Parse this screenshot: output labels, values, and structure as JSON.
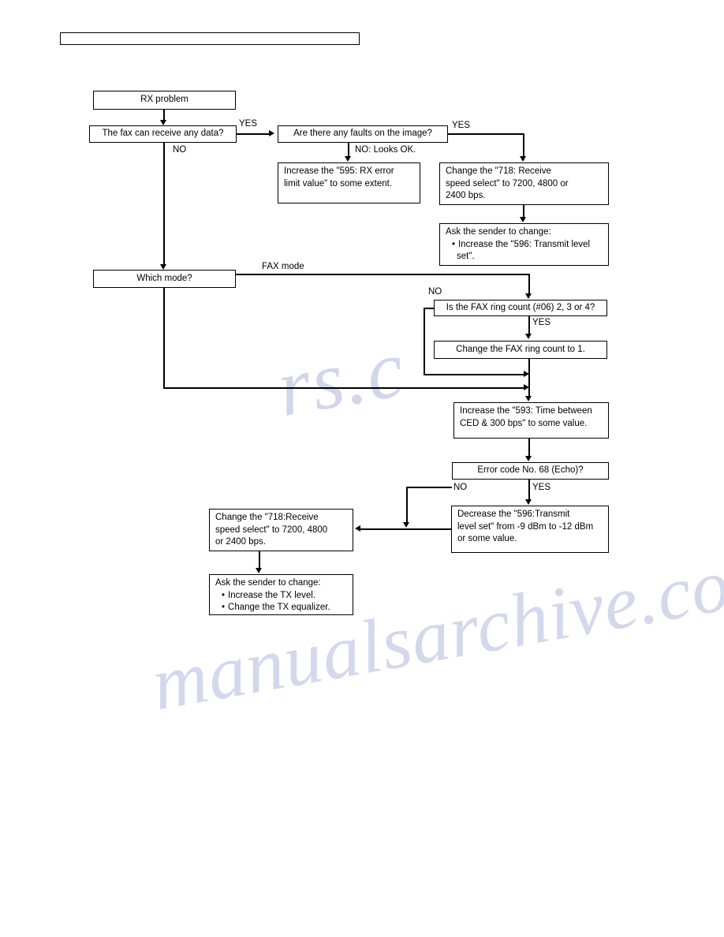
{
  "document": {
    "title": "RX problem troubleshooting flowchart",
    "header_rule_text": ""
  },
  "watermark": {
    "line1": "rs.c",
    "line2": "manualsarchive.com"
  },
  "flowchart": {
    "type": "flowchart",
    "nodes": [
      {
        "id": "rx_problem",
        "label": "RX problem"
      },
      {
        "id": "can_receive",
        "label": "The fax can receive any data?"
      },
      {
        "id": "faults_image",
        "label": "Are there any faults on the image?"
      },
      {
        "id": "inc_595",
        "line1": "Increase the \"595: RX error",
        "line2": "limit value\" to some extent."
      },
      {
        "id": "change_718_top",
        "line1": "Change the \"718: Receive",
        "line2": "speed select\" to 7200, 4800 or",
        "line3": "2400 bps."
      },
      {
        "id": "ask_sender_top",
        "line1": "Ask the sender to change:",
        "line2": "Increase the \"596: Transmit level",
        "line3": "set\"."
      },
      {
        "id": "which_mode",
        "label": "Which mode?"
      },
      {
        "id": "ring_count_q",
        "label": "Is the FAX ring count (#06) 2, 3 or 4?"
      },
      {
        "id": "change_ring_count",
        "label": "Change the FAX ring count to 1."
      },
      {
        "id": "inc_593",
        "line1": "Increase the \"593: Time between",
        "line2": "CED & 300 bps\" to some value."
      },
      {
        "id": "error_code_68",
        "label": "Error code No. 68 (Echo)?"
      },
      {
        "id": "dec_596",
        "line1": "Decrease the \"596:Transmit",
        "line2": "level set\" from -9 dBm to -12 dBm",
        "line3": "or some value."
      },
      {
        "id": "change_718_bottom",
        "line1": "Change the \"718:Receive",
        "line2": "speed select\" to 7200, 4800",
        "line3": "or 2400 bps."
      },
      {
        "id": "ask_sender_bottom",
        "line1": "Ask the sender to change:",
        "line2": "Increase the TX level.",
        "line3": "Change the TX equalizer."
      }
    ],
    "edge_labels": {
      "yes_receive": "YES",
      "no_receive": "NO",
      "yes_faults": "YES",
      "no_faults": "NO: Looks OK.",
      "fax_mode": "FAX mode",
      "no_ring": "NO",
      "yes_ring": "YES",
      "no_error": "NO",
      "yes_error": "YES"
    }
  }
}
